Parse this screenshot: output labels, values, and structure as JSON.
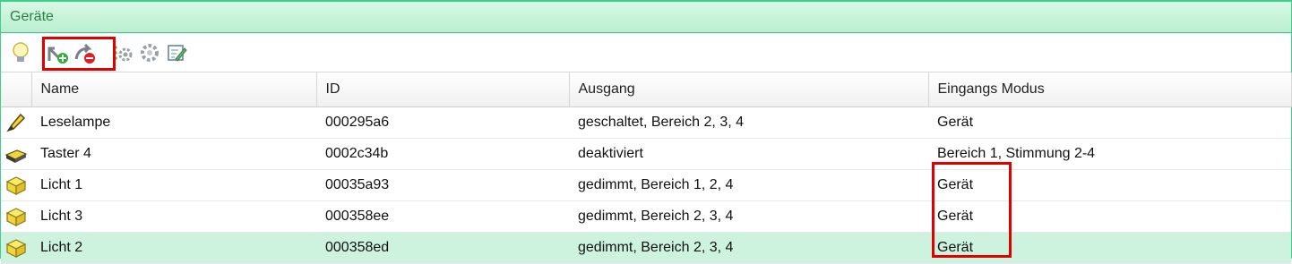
{
  "panel": {
    "title": "Geräte"
  },
  "toolbar": {
    "buttons": [
      {
        "icon": "lightbulb-icon"
      },
      {
        "icon": "add-device-icon"
      },
      {
        "icon": "remove-device-icon"
      },
      {
        "icon": "settings-dots-icon"
      },
      {
        "icon": "gear-icon"
      },
      {
        "icon": "edit-icon"
      }
    ]
  },
  "table": {
    "columns": [
      "Name",
      "ID",
      "Ausgang",
      "Eingangs Modus"
    ],
    "rows": [
      {
        "icon": "pen-lamp-icon",
        "name": "Leselampe",
        "id": "000295a6",
        "ausgang": "geschaltet, Bereich 2, 3, 4",
        "modus": "Gerät"
      },
      {
        "icon": "switch-icon",
        "name": "Taster 4",
        "id": "0002c34b",
        "ausgang": "deaktiviert",
        "modus": "Bereich 1, Stimmung 2-4"
      },
      {
        "icon": "light-cube-icon",
        "name": "Licht 1",
        "id": "00035a93",
        "ausgang": "gedimmt, Bereich 1, 2, 4",
        "modus": "Gerät"
      },
      {
        "icon": "light-cube-icon",
        "name": "Licht 3",
        "id": "000358ee",
        "ausgang": "gedimmt, Bereich 2, 3, 4",
        "modus": "Gerät"
      },
      {
        "icon": "light-cube-icon",
        "name": "Licht 2",
        "id": "000358ed",
        "ausgang": "gedimmt, Bereich 2, 3, 4",
        "modus": "Gerät"
      }
    ]
  },
  "colors": {
    "accent": "#3ecf8e",
    "selected_row": "#cdf3df",
    "highlight": "#e00000"
  }
}
